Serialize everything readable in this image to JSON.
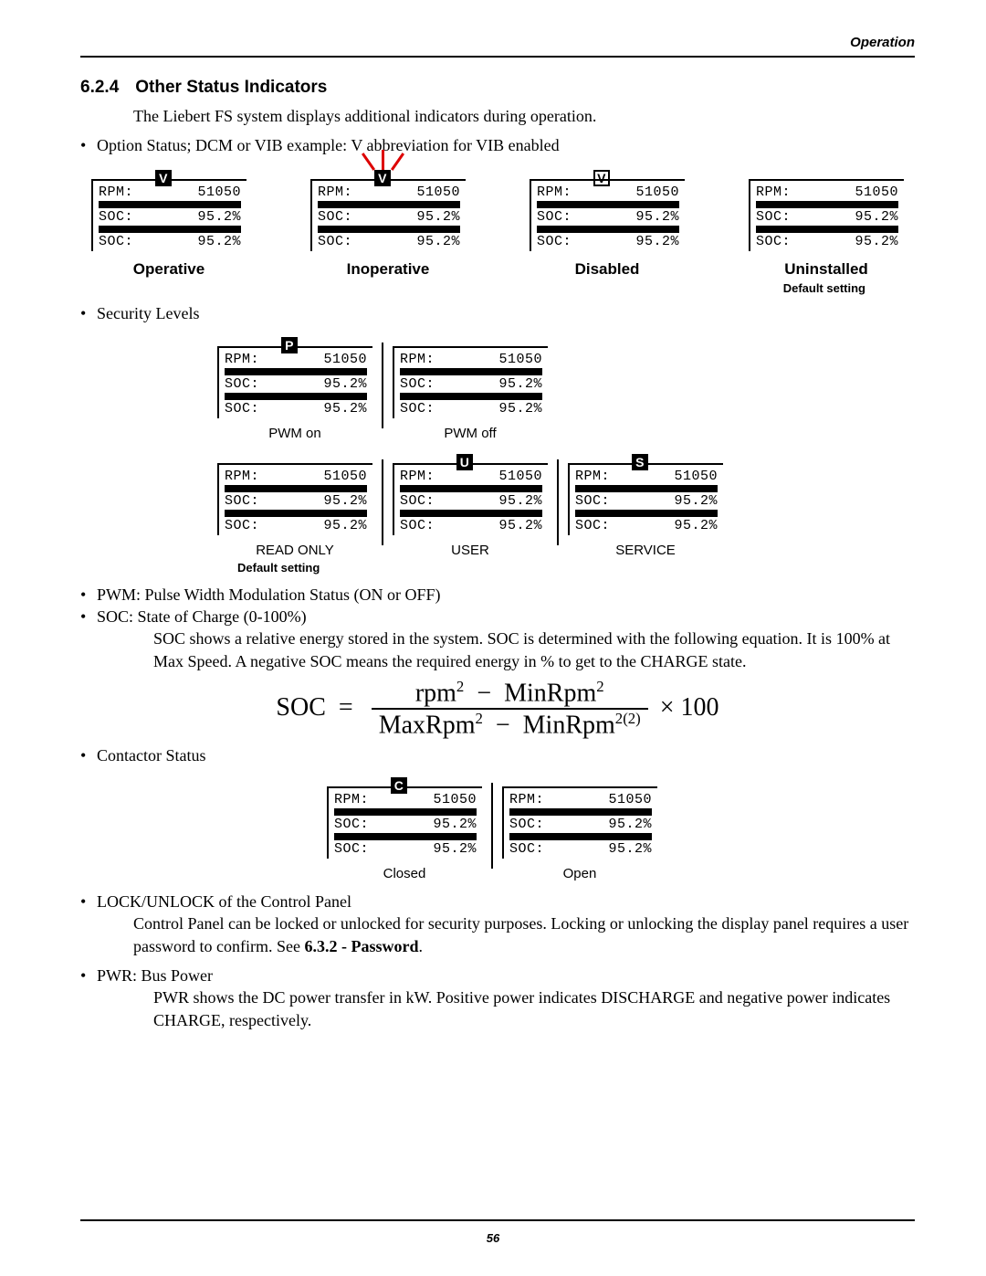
{
  "header": {
    "running_head": "Operation",
    "page_number": "56"
  },
  "section": {
    "number": "6.2.4",
    "title": "Other Status Indicators",
    "intro": "The Liebert FS system displays additional indicators during operation.",
    "bullet_option": "Option Status; DCM or VIB example: V abbreviation for VIB enabled",
    "bullet_security": "Security Levels",
    "bullet_pwm": "PWM: Pulse Width Modulation Status (ON or OFF)",
    "bullet_soc": "SOC: State of Charge (0-100%)",
    "soc_text": "SOC shows a relative energy stored in the system. SOC is determined with the following equation. It is 100% at Max Speed. A negative SOC means the required energy in % to get to the CHARGE state.",
    "bullet_contactor": "Contactor Status",
    "bullet_lock": "LOCK/UNLOCK of the Control Panel",
    "lock_text_a": "Control Panel can be locked or unlocked for security purposes. Locking or unlocking the display panel requires a user password to confirm. See ",
    "lock_text_ref": "6.3.2 - Password",
    "lock_text_b": ".",
    "bullet_pwr": "PWR: Bus Power",
    "pwr_text": "PWR shows the DC power transfer in kW. Positive power indicates DISCHARGE and negative power indicates CHARGE, respectively."
  },
  "default_setting": "Default setting",
  "lcd": {
    "rpm_label": "RPM:",
    "soc_label": "SOC:",
    "rpm_value": "51050",
    "soc_value": "95.2%"
  },
  "option_row": {
    "states": [
      {
        "caption": "Operative",
        "badge": "V",
        "inv": true,
        "flash": false
      },
      {
        "caption": "Inoperative",
        "badge": "V",
        "inv": true,
        "flash": true
      },
      {
        "caption": "Disabled",
        "badge": "V",
        "inv": false,
        "flash": false
      },
      {
        "caption": "Uninstalled",
        "badge": "",
        "inv": false,
        "flash": false
      }
    ]
  },
  "security_rows": {
    "pwm": [
      {
        "label": "PWM on",
        "badge": "P",
        "inv": true
      },
      {
        "label": "PWM off",
        "badge": "",
        "inv": false
      }
    ],
    "access": [
      {
        "label": "READ ONLY",
        "badge": "",
        "inv": false
      },
      {
        "label": "USER",
        "badge": "U",
        "inv": true
      },
      {
        "label": "SERVICE",
        "badge": "S",
        "inv": true
      }
    ]
  },
  "contactor_row": [
    {
      "label": "Closed",
      "badge": "C",
      "inv": true
    },
    {
      "label": "Open",
      "badge": "",
      "inv": false
    }
  ],
  "equation": {
    "lhs": "SOC",
    "num_a": "rpm",
    "num_b": "MinRpm",
    "den_a": "MaxRpm",
    "den_b": "MinRpm",
    "den_exp": "2(2)",
    "tail": "× 100"
  }
}
